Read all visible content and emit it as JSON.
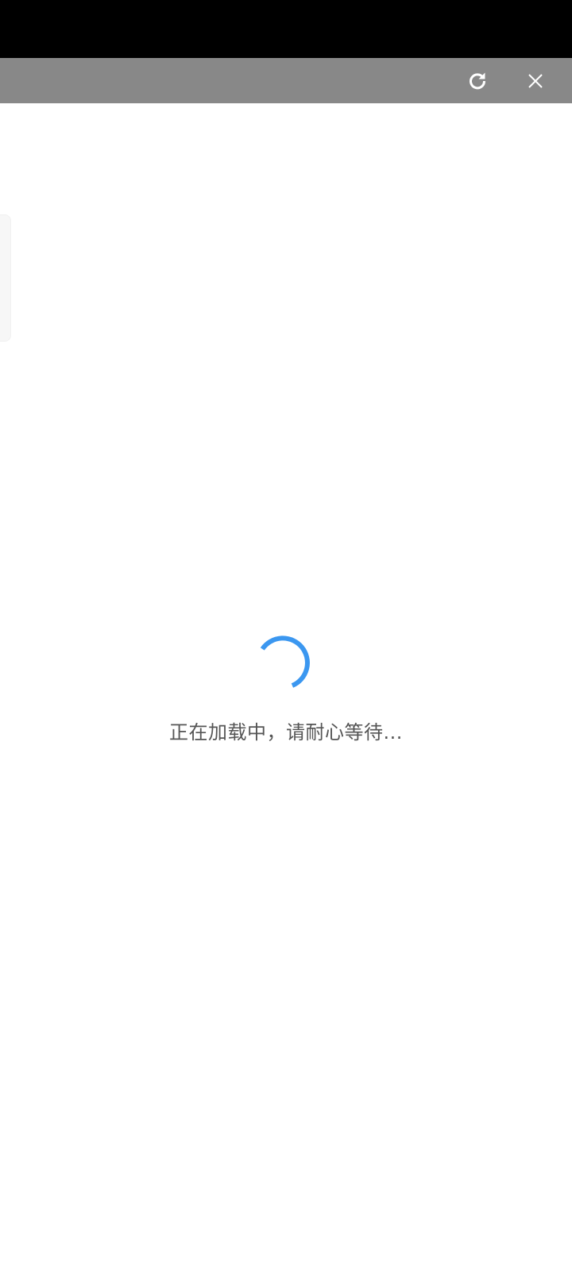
{
  "header": {
    "refresh_icon": "refresh-icon",
    "close_icon": "close-icon"
  },
  "loading": {
    "message": "正在加载中，请耐心等待...",
    "spinner_color": "#3b97f0"
  },
  "colors": {
    "status_bar": "#000000",
    "top_bar": "#888888",
    "background": "#ffffff"
  }
}
